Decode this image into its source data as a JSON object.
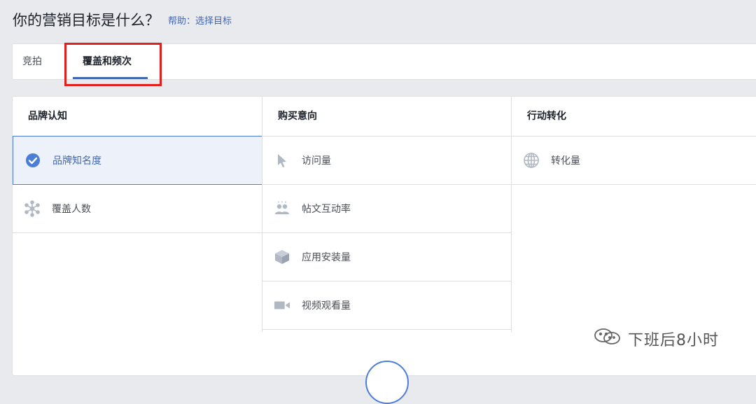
{
  "header": {
    "title": "你的营销目标是什么？",
    "help": "帮助：选择目标"
  },
  "tabs": [
    {
      "label": "竞拍"
    },
    {
      "label": "覆盖和频次"
    }
  ],
  "columns": [
    {
      "title": "品牌认知",
      "items": [
        {
          "label": "品牌知名度",
          "icon": "check-circle-icon",
          "selected": true
        },
        {
          "label": "覆盖人数",
          "icon": "reach-icon"
        }
      ]
    },
    {
      "title": "购买意向",
      "items": [
        {
          "label": "访问量",
          "icon": "cursor-icon"
        },
        {
          "label": "帖文互动率",
          "icon": "people-icon"
        },
        {
          "label": "应用安装量",
          "icon": "box-icon"
        },
        {
          "label": "视频观看量",
          "icon": "video-camera-icon"
        }
      ]
    },
    {
      "title": "行动转化",
      "items": [
        {
          "label": "转化量",
          "icon": "globe-icon"
        }
      ]
    }
  ],
  "watermark": "下班后8小时",
  "colors": {
    "accent": "#4267b2",
    "highlight": "#e0201e"
  }
}
